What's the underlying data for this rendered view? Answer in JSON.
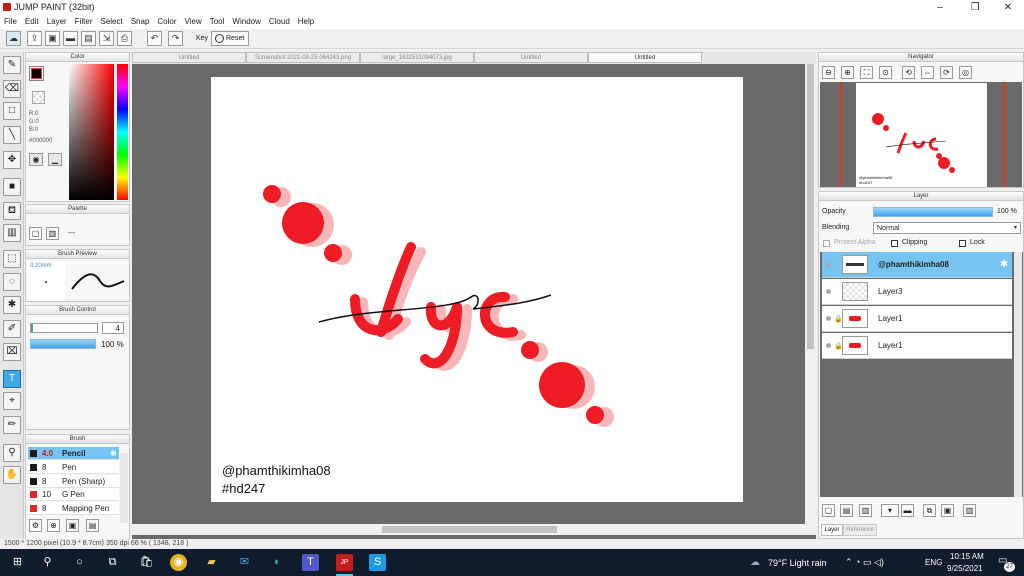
{
  "window": {
    "title": "JUMP PAINT (32bit)",
    "minimize": "–",
    "maximize": "❐",
    "close": "✕"
  },
  "menu": [
    "File",
    "Edit",
    "Layer",
    "Filter",
    "Select",
    "Snap",
    "Color",
    "View",
    "Tool",
    "Window",
    "Cloud",
    "Help"
  ],
  "toolbar": {
    "key_label": "Key",
    "reset_label": "Reset"
  },
  "color_panel": {
    "title": "Color",
    "r": "R:0",
    "g": "G:0",
    "b": "B:0",
    "hex": "#000000",
    "current_color": "#000000"
  },
  "palette_panel": {
    "title": "Palette",
    "value": "---"
  },
  "brush_preview": {
    "title": "Brush Preview",
    "size": "0.20mm"
  },
  "brush_control": {
    "title": "Brush Control",
    "size_value": "4",
    "opacity_value": "100 %",
    "opacity_fraction": 1.0
  },
  "brush_panel": {
    "title": "Brush",
    "items": [
      {
        "size": "4.0",
        "name": "Pencil",
        "color": "#1a1a1a",
        "selected": true
      },
      {
        "size": "8",
        "name": "Pen",
        "color": "#1a1a1a",
        "selected": false
      },
      {
        "size": "8",
        "name": "Pen (Sharp)",
        "color": "#1a1a1a",
        "selected": false
      },
      {
        "size": "10",
        "name": "G Pen",
        "color": "#e0282a",
        "selected": false
      },
      {
        "size": "8",
        "name": "Mapping Pen",
        "color": "#e0282a",
        "selected": false
      }
    ]
  },
  "tabs": [
    "Untitled",
    "Screenshot 2021-09-25 064243.png",
    "large_1632531094073.jpg",
    "Untitled",
    "Untitled"
  ],
  "active_tab": 4,
  "canvas": {
    "word": "Lyc",
    "handle": "@phamthikimha08",
    "tag": "#hd247",
    "accent": "#ee1c24",
    "shadow": "#f7b6b8"
  },
  "navigator": {
    "title": "Navigator",
    "thumb_text1": "@phamthikimha08",
    "thumb_text2": "#hd247"
  },
  "layer_panel": {
    "title": "Layer",
    "opacity_label": "Opacity",
    "opacity_value": "100 %",
    "blending_label": "Blending",
    "blending_value": "Normal",
    "protect_alpha": "Protect Alpha",
    "clipping": "Clipping",
    "lock": "Lock",
    "layers": [
      {
        "name": "@phamthikimha08",
        "selected": true
      },
      {
        "name": "Layer3",
        "selected": false
      },
      {
        "name": "Layer1",
        "selected": false
      },
      {
        "name": "Layer1",
        "selected": false
      }
    ],
    "tab_layer": "Layer",
    "tab_reference": "Reference"
  },
  "status": {
    "text": "1500 * 1200 pixel   (10.9 * 8.7cm)   350 dpi   66 %   ( 1348, 218 )"
  },
  "taskbar": {
    "weather": "79°F  Light rain",
    "lang": "ENG",
    "time": "10:15 AM",
    "date": "9/25/2021",
    "notif": "27"
  }
}
